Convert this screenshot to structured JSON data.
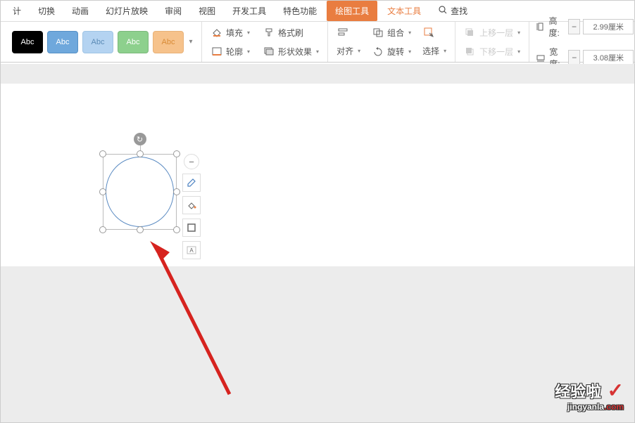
{
  "menubar": {
    "items": [
      "计",
      "切换",
      "动画",
      "幻灯片放映",
      "审阅",
      "视图",
      "开发工具",
      "特色功能"
    ],
    "drawing_tools": "绘图工具",
    "text_tools": "文本工具",
    "find": "查找"
  },
  "toolbar": {
    "presets": {
      "abc": "Abc"
    },
    "fill": "填充",
    "format_brush": "格式刷",
    "outline": "轮廓",
    "shape_effects": "形状效果",
    "align": "对齐",
    "combine": "组合",
    "rotate": "旋转",
    "select": "选择",
    "bring_forward": "上移一层",
    "send_backward": "下移一层",
    "height_label": "高度:",
    "height_value": "2.99厘米",
    "width_label": "宽度:",
    "width_value": "3.08厘米",
    "minus": "−",
    "plus": "+"
  },
  "float_icons": {
    "collapse": "−",
    "pencil": "✎",
    "fill_bucket": "◇",
    "outline": "▢",
    "text": "A"
  },
  "watermark": {
    "main": "经验啦",
    "check": "✓",
    "sub_plain": "jingyanla",
    "sub_red": ".com"
  }
}
